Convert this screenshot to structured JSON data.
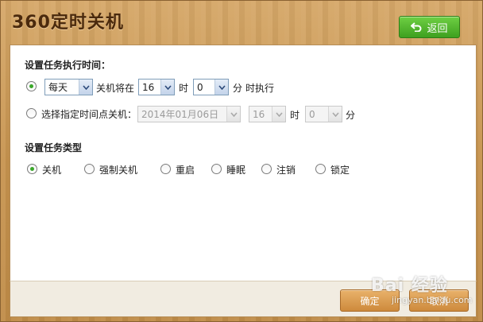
{
  "app": {
    "title": "360定时关机"
  },
  "header": {
    "back_label": "返回"
  },
  "section_time": {
    "title": "设置任务执行时间：",
    "daily": {
      "frequency": "每天",
      "text_before": "关机将在",
      "hour": "16",
      "hour_unit": "时",
      "minute": "0",
      "minute_unit": "分",
      "text_after": "时执行"
    },
    "specific": {
      "label": "选择指定时间点关机：",
      "date": "2014年01月06日",
      "hour": "16",
      "hour_unit": "时",
      "minute": "0",
      "minute_unit": "分"
    }
  },
  "section_type": {
    "title": "设置任务类型",
    "options": [
      "关机",
      "强制关机",
      "重启",
      "睡眠",
      "注销",
      "锁定"
    ]
  },
  "footer": {
    "ok_label": "确定",
    "cancel_label": "取消"
  },
  "watermark": {
    "brand": "Bai 经验",
    "sub": "jingyan.baidu.com"
  },
  "colors": {
    "accent_green": "#3ea01f",
    "wood": "#c7944f",
    "button_orange": "#cd8a3c"
  }
}
